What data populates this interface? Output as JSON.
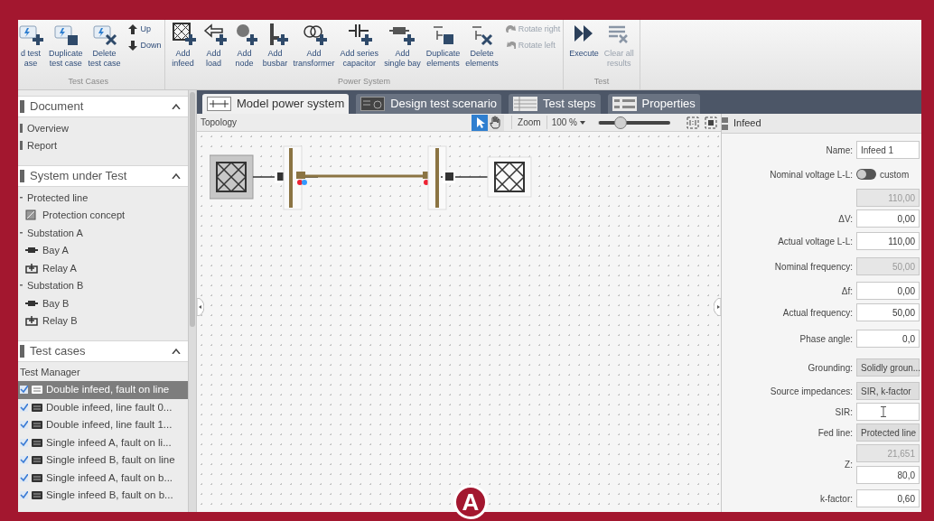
{
  "ribbon": {
    "groups": [
      {
        "title": "Test Cases",
        "buttons": [
          {
            "label": "d test\nase",
            "disabled": false
          },
          {
            "label": "Duplicate\ntest case",
            "disabled": false
          },
          {
            "label": "Delete\ntest case",
            "disabled": false
          }
        ],
        "small": [
          {
            "label": "Up",
            "disabled": false
          },
          {
            "label": "Down",
            "disabled": false
          }
        ]
      },
      {
        "title": "Power System",
        "buttons": [
          {
            "label": "Add\ninfeed",
            "disabled": false
          },
          {
            "label": "Add\nload",
            "disabled": false
          },
          {
            "label": "Add\nnode",
            "disabled": false
          },
          {
            "label": "Add\nbusbar",
            "disabled": false
          },
          {
            "label": "Add\ntransformer",
            "disabled": false
          },
          {
            "label": "Add series\ncapacitor",
            "disabled": false
          },
          {
            "label": "Add\nsingle bay",
            "disabled": false
          },
          {
            "label": "Duplicate\nelements",
            "disabled": false
          },
          {
            "label": "Delete\nelements",
            "disabled": false
          }
        ],
        "small": [
          {
            "label": "Rotate right",
            "disabled": true
          },
          {
            "label": "Rotate left",
            "disabled": true
          }
        ]
      },
      {
        "title": "Test",
        "buttons": [
          {
            "label": "Execute",
            "disabled": false
          },
          {
            "label": "Clear all\nresults",
            "disabled": true
          }
        ]
      }
    ]
  },
  "sidebar": {
    "sections": [
      {
        "title": "Document",
        "expanded": true,
        "items": [
          {
            "label": "Overview",
            "kind": "plain"
          },
          {
            "label": "Report",
            "kind": "plain"
          }
        ]
      },
      {
        "title": "System under Test",
        "expanded": true,
        "items": [
          {
            "label": "Protected line",
            "kind": "group",
            "children": [
              {
                "label": "Protection concept",
                "kind": "concept"
              }
            ]
          },
          {
            "label": "Substation A",
            "kind": "group",
            "children": [
              {
                "label": "Bay A",
                "kind": "bay"
              },
              {
                "label": "Relay A",
                "kind": "relay"
              }
            ]
          },
          {
            "label": "Substation B",
            "kind": "group",
            "children": [
              {
                "label": "Bay B",
                "kind": "bay"
              },
              {
                "label": "Relay B",
                "kind": "relay"
              }
            ]
          }
        ]
      },
      {
        "title": "Test cases",
        "expanded": true,
        "manager": "Test Manager",
        "cases": [
          {
            "label": "Double infeed, fault on line",
            "checked": true,
            "selected": true
          },
          {
            "label": "Double infeed, line fault 0...",
            "checked": true,
            "selected": false
          },
          {
            "label": "Double infeed, line fault 1...",
            "checked": true,
            "selected": false
          },
          {
            "label": "Single infeed A, fault on li...",
            "checked": true,
            "selected": false
          },
          {
            "label": "Single infeed B, fault on line",
            "checked": true,
            "selected": false
          },
          {
            "label": "Single infeed A, fault on b...",
            "checked": true,
            "selected": false
          },
          {
            "label": "Single infeed B, fault on b...",
            "checked": true,
            "selected": false
          }
        ]
      }
    ]
  },
  "tabs": [
    {
      "label": "Model power system",
      "selected": true
    },
    {
      "label": "Design test scenario",
      "selected": false
    },
    {
      "label": "Test steps",
      "selected": false
    },
    {
      "label": "Properties",
      "selected": false
    }
  ],
  "toolbar": {
    "title": "Topology",
    "tools": [
      {
        "kind": "pointer",
        "selected": true
      },
      {
        "kind": "hand",
        "selected": false
      }
    ],
    "zoom_label": "Zoom",
    "zoom_value": "100 %",
    "zoom_slider": {
      "level": 0.3
    }
  },
  "properties": {
    "title": "Infeed",
    "rows": [
      {
        "label": "Name:",
        "kind": "text",
        "value": "Infeed 1"
      },
      {
        "label": "Nominal voltage L-L:",
        "kind": "toggle",
        "on": false,
        "value": "custom"
      },
      {
        "kind": "readonly",
        "value": "110,00"
      },
      {
        "label": "ΔV:",
        "kind": "number",
        "value": "0,00"
      },
      {
        "label": "Actual voltage L-L:",
        "kind": "number",
        "value": "110,00"
      },
      {
        "label": "Nominal frequency:",
        "kind": "readonly",
        "value": "50,00"
      },
      {
        "label": "Δf:",
        "kind": "number",
        "value": "0,00"
      },
      {
        "label": "Actual frequency:",
        "kind": "number",
        "value": "50,00"
      },
      {
        "label": "Phase angle:",
        "kind": "number",
        "value": "0,0"
      },
      {
        "label": "Grounding:",
        "kind": "dropdown",
        "value": "Solidly groun..."
      },
      {
        "label": "Source impedances:",
        "kind": "dropdown",
        "value": "SIR, k-factor"
      },
      {
        "label": "SIR:",
        "kind": "text"
      },
      {
        "label": "Fed line:",
        "kind": "dropdown",
        "value": "Protected line"
      },
      {
        "label": "Z:",
        "kind": "pair",
        "values": [
          "21,651",
          "80,0"
        ]
      },
      {
        "label": "k-factor:",
        "kind": "number",
        "value": "0,60"
      }
    ]
  },
  "marker": "A"
}
